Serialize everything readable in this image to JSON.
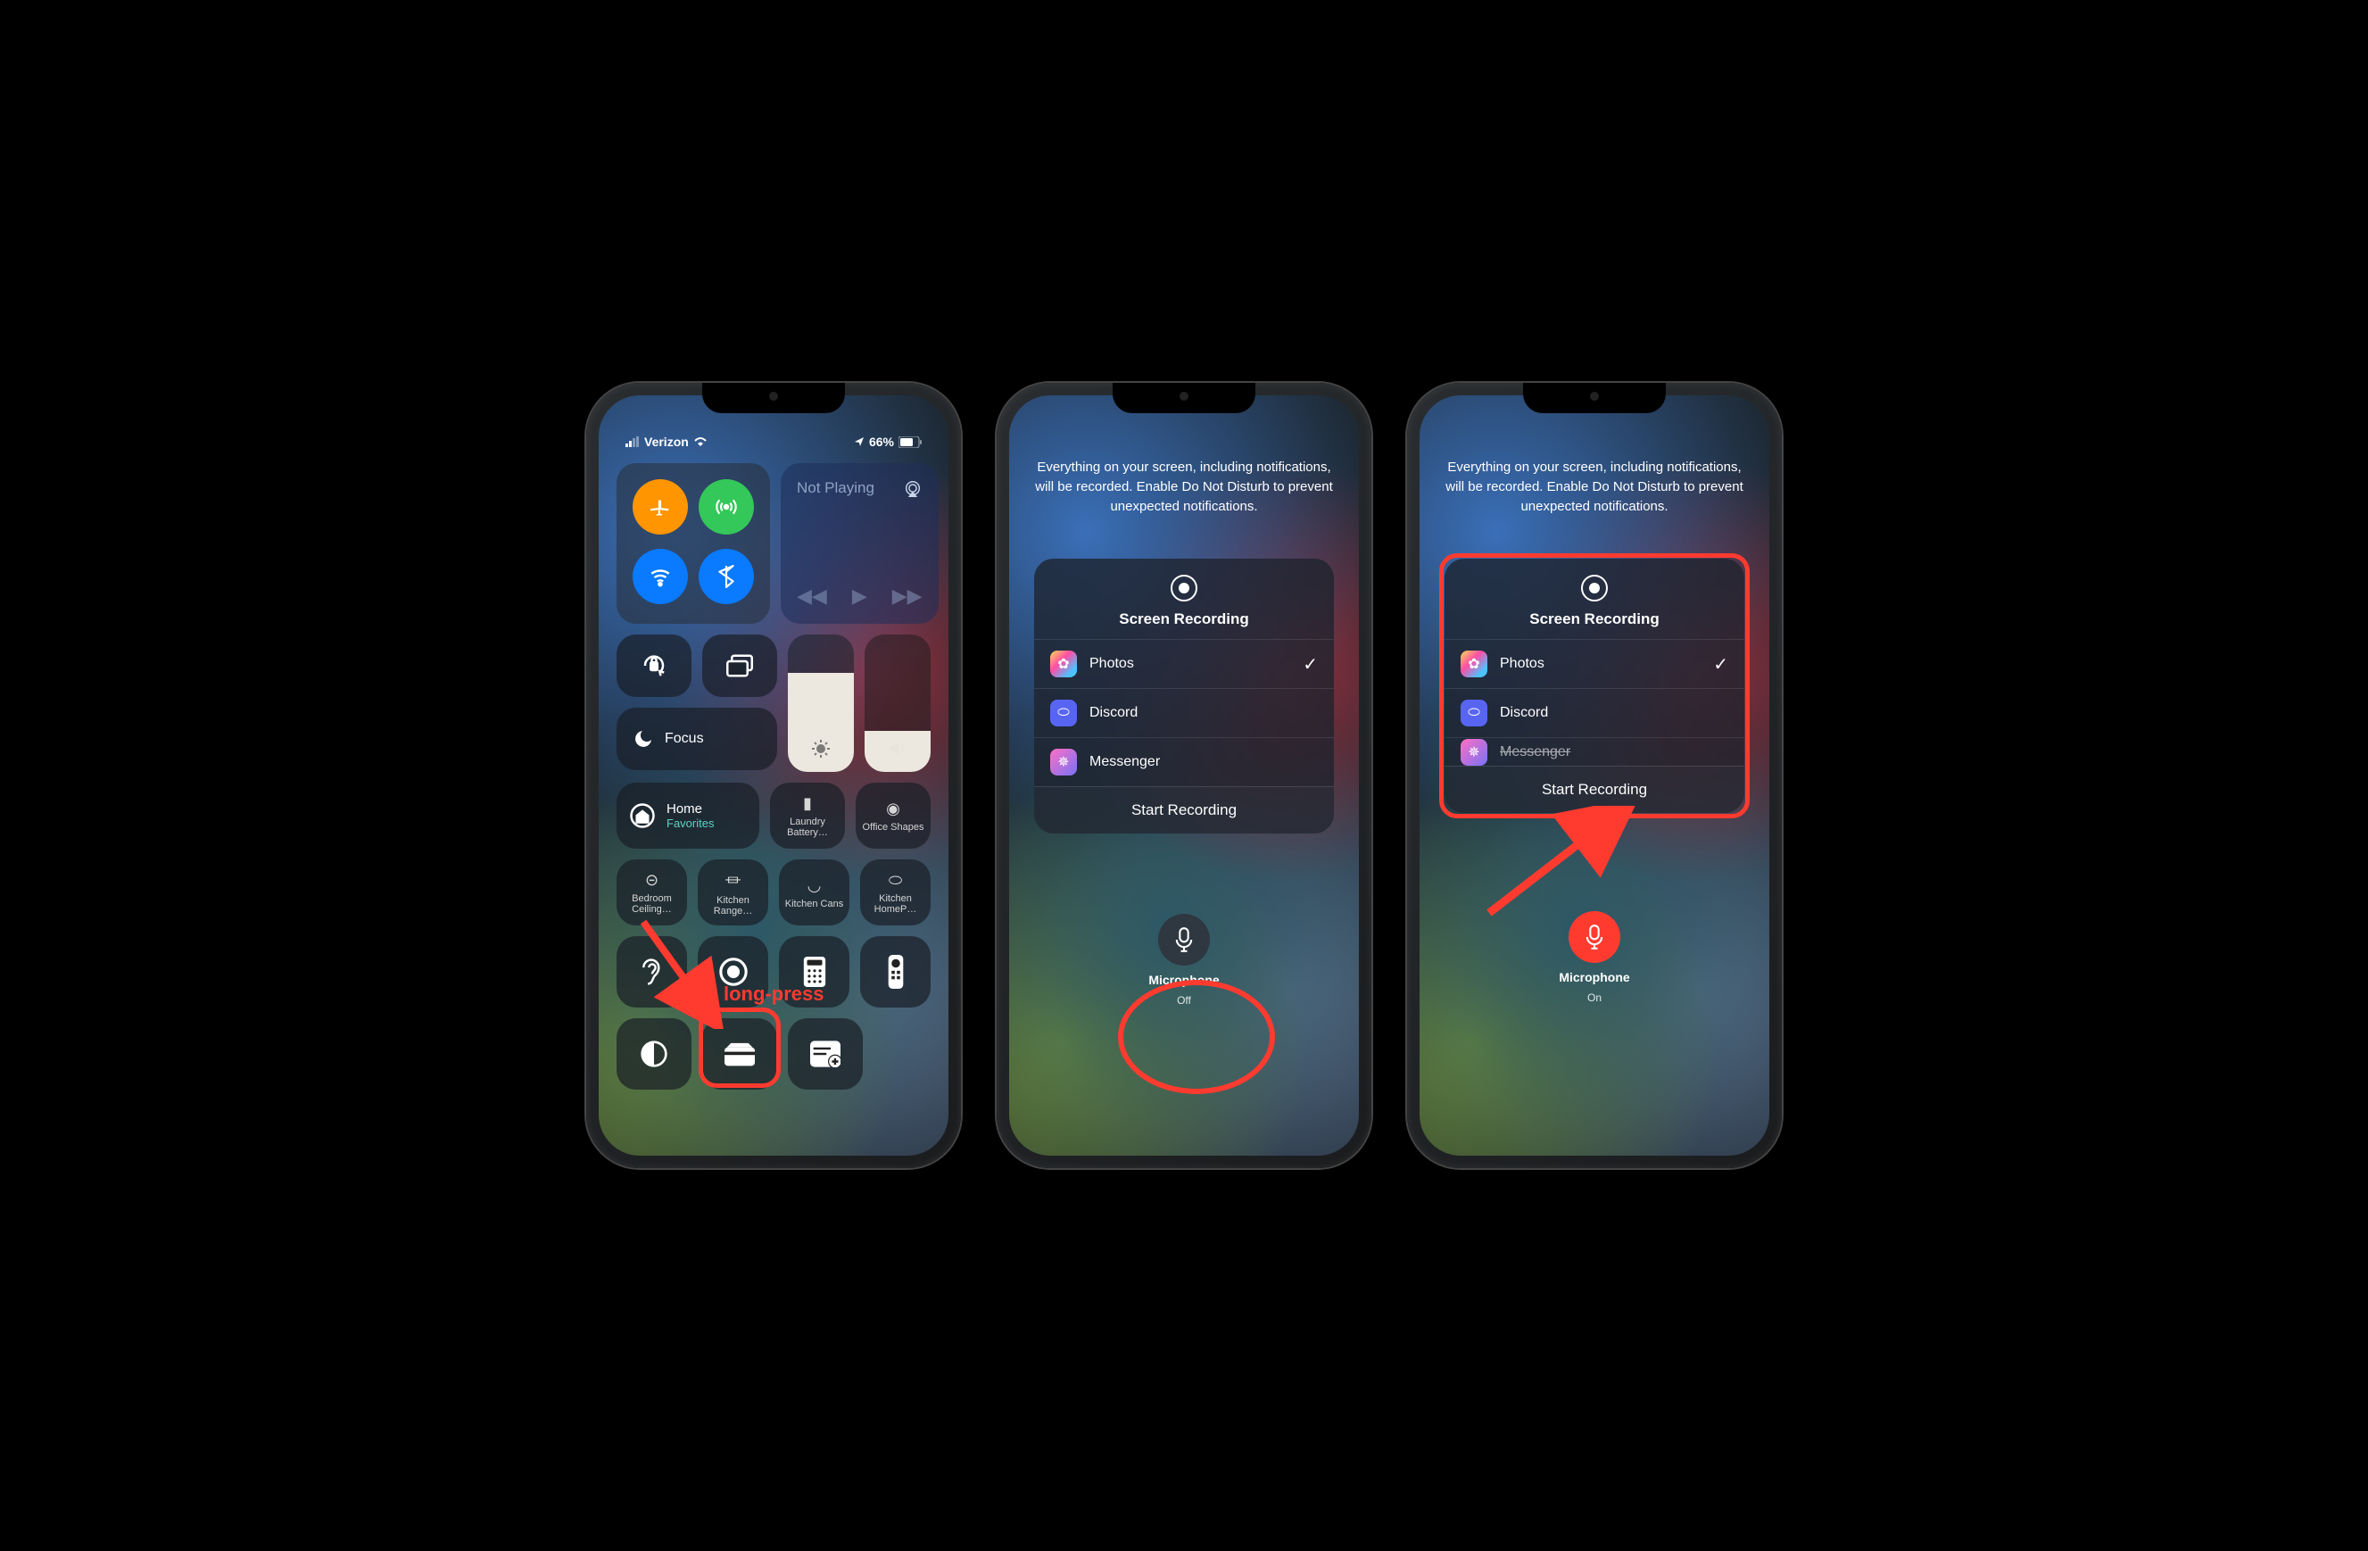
{
  "statusbar": {
    "carrier": "Verizon",
    "battery_pct": "66%"
  },
  "connectivity": {
    "airplane": "airplane",
    "cellular": "cellular",
    "wifi": "wifi",
    "bluetooth": "bluetooth"
  },
  "media": {
    "title": "Not Playing"
  },
  "focus": {
    "label": "Focus"
  },
  "home_module": {
    "title": "Home",
    "subtitle": "Favorites"
  },
  "accessories": [
    {
      "label": "Laundry Battery…"
    },
    {
      "label": "Office Shapes"
    },
    {
      "label": "Bedroom Ceiling…"
    },
    {
      "label": "Kitchen Range…"
    },
    {
      "label": "Kitchen Cans"
    },
    {
      "label": "Kitchen HomeP…"
    }
  ],
  "annotation": {
    "longpress": "long-press"
  },
  "recording_info": "Everything on your screen, including notifications, will be recorded. Enable Do Not Disturb to prevent unexpected notifications.",
  "recording_sheet": {
    "title": "Screen Recording",
    "destinations": [
      {
        "name": "Photos",
        "selected": true,
        "icon": "photos"
      },
      {
        "name": "Discord",
        "selected": false,
        "icon": "discord"
      },
      {
        "name": "Messenger",
        "selected": false,
        "icon": "messenger"
      }
    ],
    "start_label": "Start Recording"
  },
  "microphone": {
    "label": "Microphone",
    "state_off": "Off",
    "state_on": "On"
  }
}
